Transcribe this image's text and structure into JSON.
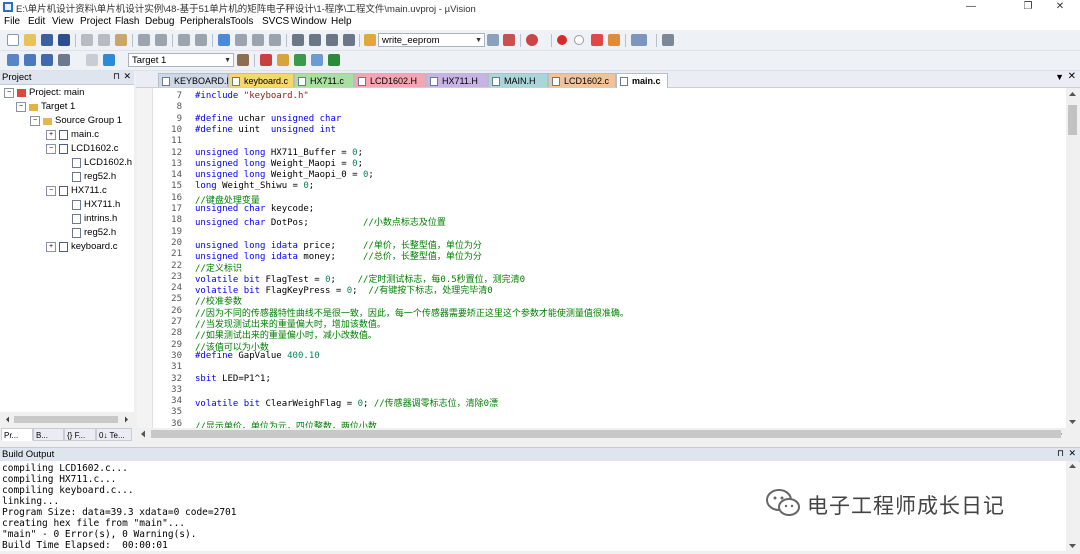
{
  "window": {
    "title": "E:\\单片机设计资料\\单片机设计实例\\48-基于51单片机的矩阵电子秤设计\\1-程序\\工程文件\\main.uvproj - µVision",
    "min_glyph": "—",
    "max_glyph": "❐",
    "close_glyph": "✕"
  },
  "menu": [
    "File",
    "Edit",
    "View",
    "Project",
    "Flash",
    "Debug",
    "Peripherals",
    "Tools",
    "SVCS",
    "Window",
    "Help"
  ],
  "toolbar": {
    "find_combo": "write_eeprom",
    "target_combo": "Target 1"
  },
  "project_panel": {
    "title": "Project",
    "pin": "⊓",
    "close": "✕",
    "tree": [
      {
        "label": "Project: main",
        "exp": "−"
      },
      {
        "label": "Target 1",
        "exp": "−"
      },
      {
        "label": "Source Group 1",
        "exp": "−"
      },
      {
        "label": "main.c",
        "exp": "+"
      },
      {
        "label": "LCD1602.c",
        "exp": "−"
      },
      {
        "label": "LCD1602.h",
        "exp": ""
      },
      {
        "label": "reg52.h",
        "exp": ""
      },
      {
        "label": "HX711.c",
        "exp": "−"
      },
      {
        "label": "HX711.h",
        "exp": ""
      },
      {
        "label": "intrins.h",
        "exp": ""
      },
      {
        "label": "reg52.h",
        "exp": ""
      },
      {
        "label": "keyboard.c",
        "exp": "+"
      }
    ],
    "tabs": [
      "Pr...",
      "B...",
      "{} F...",
      "0↓ Te..."
    ]
  },
  "editor": {
    "tabs": [
      {
        "label": "KEYBOARD.H",
        "color": "#cfd8e6"
      },
      {
        "label": "keyboard.c",
        "color": "#f6d76a"
      },
      {
        "label": "HX711.c",
        "color": "#a8e0a0"
      },
      {
        "label": "LCD1602.H",
        "color": "#f4a6b0"
      },
      {
        "label": "HX711.H",
        "color": "#c9b3e6"
      },
      {
        "label": "MAIN.H",
        "color": "#a9d7d9"
      },
      {
        "label": "LCD1602.c",
        "color": "#f1c39c"
      },
      {
        "label": "main.c",
        "color": "#ffffff"
      }
    ],
    "active_tab": "main.c",
    "tab_menu_glyph": "▼",
    "tab_close_glyph": "✕",
    "lines": [
      {
        "n": "7",
        "t": [
          [
            "pp",
            "#include "
          ],
          [
            "st",
            "\"keyboard.h\""
          ]
        ]
      },
      {
        "n": "8",
        "t": []
      },
      {
        "n": "9",
        "t": [
          [
            "pp",
            "#define "
          ],
          [
            "",
            "uchar "
          ],
          [
            "kw",
            "unsigned char"
          ]
        ]
      },
      {
        "n": "10",
        "t": [
          [
            "pp",
            "#define "
          ],
          [
            "",
            "uint  "
          ],
          [
            "kw",
            "unsigned int"
          ]
        ]
      },
      {
        "n": "11",
        "t": []
      },
      {
        "n": "12",
        "t": [
          [
            "kw",
            "unsigned long "
          ],
          [
            "",
            "HX711_Buffer = "
          ],
          [
            "num",
            "0"
          ],
          [
            "",
            ";"
          ]
        ]
      },
      {
        "n": "13",
        "t": [
          [
            "kw",
            "unsigned long "
          ],
          [
            "",
            "Weight_Maopi = "
          ],
          [
            "num",
            "0"
          ],
          [
            "",
            ";"
          ]
        ]
      },
      {
        "n": "14",
        "t": [
          [
            "kw",
            "unsigned long "
          ],
          [
            "",
            "Weight_Maopi_0 = "
          ],
          [
            "num",
            "0"
          ],
          [
            "",
            ";"
          ]
        ]
      },
      {
        "n": "15",
        "t": [
          [
            "kw",
            "long "
          ],
          [
            "",
            "Weight_Shiwu = "
          ],
          [
            "num",
            "0"
          ],
          [
            "",
            ";"
          ]
        ]
      },
      {
        "n": "16",
        "t": [
          [
            "cm",
            "//键盘处理变量"
          ]
        ]
      },
      {
        "n": "17",
        "t": [
          [
            "kw",
            "unsigned char "
          ],
          [
            "",
            "keycode;"
          ]
        ]
      },
      {
        "n": "18",
        "t": [
          [
            "kw",
            "unsigned char "
          ],
          [
            "",
            "DotPos;          "
          ],
          [
            "cm",
            "//小数点标志及位置"
          ]
        ]
      },
      {
        "n": "19",
        "t": []
      },
      {
        "n": "20",
        "t": [
          [
            "kw",
            "unsigned long idata "
          ],
          [
            "",
            "price;     "
          ],
          [
            "cm",
            "//单价，长整型值，单位为分"
          ]
        ]
      },
      {
        "n": "21",
        "t": [
          [
            "kw",
            "unsigned long idata "
          ],
          [
            "",
            "money;     "
          ],
          [
            "cm",
            "//总价，长整型值，单位为分"
          ]
        ]
      },
      {
        "n": "22",
        "t": [
          [
            "cm",
            "//定义标识"
          ]
        ]
      },
      {
        "n": "23",
        "t": [
          [
            "kw",
            "volatile bit "
          ],
          [
            "",
            "FlagTest = "
          ],
          [
            "num",
            "0"
          ],
          [
            "",
            ";    "
          ],
          [
            "cm",
            "//定时测试标志，每0.5秒置位，测完清0"
          ]
        ]
      },
      {
        "n": "24",
        "t": [
          [
            "kw",
            "volatile bit "
          ],
          [
            "",
            "FlagKeyPress = "
          ],
          [
            "num",
            "0"
          ],
          [
            "",
            ";  "
          ],
          [
            "cm",
            "//有键按下标志，处理完毕清0"
          ]
        ]
      },
      {
        "n": "25",
        "t": [
          [
            "cm",
            "//校准参数"
          ]
        ]
      },
      {
        "n": "26",
        "t": [
          [
            "cm",
            "//因为不同的传感器特性曲线不是很一致，因此，每一个传感器需要矫正这里这个参数才能使测量值很准确。"
          ]
        ]
      },
      {
        "n": "27",
        "t": [
          [
            "cm",
            "//当发现测试出来的重量偏大时，增加该数值。"
          ]
        ]
      },
      {
        "n": "28",
        "t": [
          [
            "cm",
            "//如果测试出来的重量偏小时，减小改数值。"
          ]
        ]
      },
      {
        "n": "29",
        "t": [
          [
            "cm",
            "//该值可以为小数"
          ]
        ]
      },
      {
        "n": "30",
        "t": [
          [
            "pp",
            "#define "
          ],
          [
            "",
            "GapValue "
          ],
          [
            "num",
            "400.10"
          ]
        ]
      },
      {
        "n": "31",
        "t": []
      },
      {
        "n": "32",
        "t": [
          [
            "kw",
            "sbit "
          ],
          [
            "",
            "LED=P1^1;"
          ]
        ]
      },
      {
        "n": "33",
        "t": []
      },
      {
        "n": "34",
        "t": [
          [
            "kw",
            "volatile bit "
          ],
          [
            "",
            "ClearWeighFlag = "
          ],
          [
            "num",
            "0"
          ],
          [
            "",
            "; "
          ],
          [
            "cm",
            "//传感器调零标志位，清除0漂"
          ]
        ]
      },
      {
        "n": "35",
        "t": []
      },
      {
        "n": "36",
        "t": [
          [
            "cm",
            "//显示单价，单位为元，四位整数，两位小数"
          ]
        ]
      }
    ]
  },
  "build_output": {
    "title": "Build Output",
    "pin": "⊓",
    "close": "✕",
    "lines": [
      "compiling LCD1602.c...",
      "compiling HX711.c...",
      "compiling keyboard.c...",
      "linking...",
      "Program Size: data=39.3 xdata=0 code=2701",
      "creating hex file from \"main\"...",
      "\"main\" - 0 Error(s), 0 Warning(s).",
      "Build Time Elapsed:  00:00:01"
    ]
  },
  "watermark": {
    "text": "电子工程师成长日记"
  }
}
